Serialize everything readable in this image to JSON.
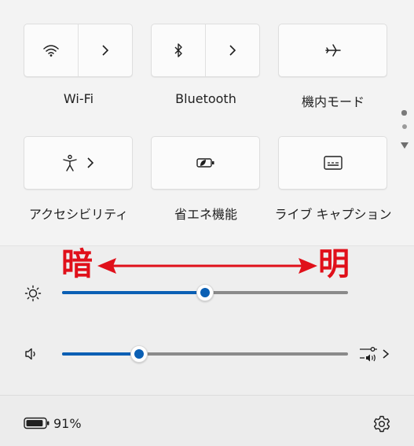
{
  "tiles": [
    {
      "label": "Wi-Fi",
      "icon": "wifi-icon",
      "has_chevron": true
    },
    {
      "label": "Bluetooth",
      "icon": "bluetooth-icon",
      "has_chevron": true
    },
    {
      "label": "機内モード",
      "icon": "airplane-icon",
      "has_chevron": false
    },
    {
      "label": "アクセシビリティ",
      "icon": "accessibility-icon",
      "has_chevron": true
    },
    {
      "label": "省エネ機能",
      "icon": "energy-saver-icon",
      "has_chevron": false
    },
    {
      "label": "ライブ キャプション",
      "icon": "live-caption-icon",
      "has_chevron": false
    }
  ],
  "annotation": {
    "dark_label": "暗",
    "bright_label": "明",
    "color": "#e0101a"
  },
  "brightness": {
    "level": 0.5,
    "icon": "sun-icon"
  },
  "volume": {
    "level": 0.27,
    "icon": "speaker-icon",
    "mixer_icon": "audio-mixer-icon"
  },
  "battery": {
    "percent_label": "91%",
    "icon": "battery-icon",
    "level": 0.91
  },
  "settings": {
    "icon": "gear-icon"
  },
  "pager": {
    "pages": 2,
    "current": 1
  },
  "colors": {
    "accent": "#0a5fb4",
    "track": "#8a8a8a",
    "background": "#f3f3f3"
  }
}
